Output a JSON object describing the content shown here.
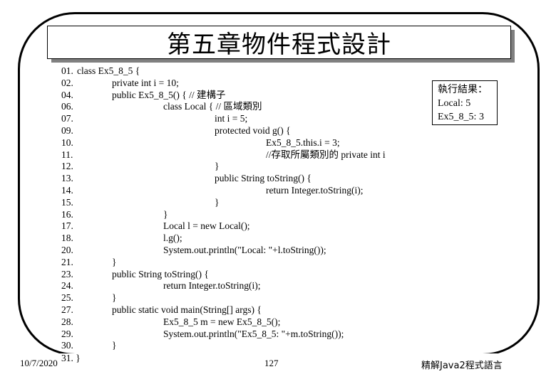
{
  "slide": {
    "title": "第五章物件程式設計",
    "footer": {
      "date": "10/7/2020",
      "page_number": "127",
      "book_title": "精解Java2程式語言"
    }
  },
  "code": {
    "lines": [
      {
        "num": "01.",
        "indent": 0,
        "text": "class Ex5_8_5 {"
      },
      {
        "num": "02.",
        "indent": 1,
        "text": "private int i = 10;"
      },
      {
        "num": "04.",
        "indent": 1,
        "text": "public Ex5_8_5() { // 建構子"
      },
      {
        "num": "06.",
        "indent": 2,
        "text": "class Local { // 區域類別"
      },
      {
        "num": "07.",
        "indent": 3,
        "text": "int i = 5;"
      },
      {
        "num": "09.",
        "indent": 3,
        "text": "protected void g() {"
      },
      {
        "num": "10.",
        "indent": 4,
        "text": "Ex5_8_5.this.i = 3;"
      },
      {
        "num": "11.",
        "indent": 4,
        "text": "//存取所屬類別的 private int i"
      },
      {
        "num": "12.",
        "indent": 3,
        "text": "}"
      },
      {
        "num": "13.",
        "indent": 3,
        "text": "public String toString() {"
      },
      {
        "num": "14.",
        "indent": 4,
        "text": "return Integer.toString(i);"
      },
      {
        "num": "15.",
        "indent": 3,
        "text": "}"
      },
      {
        "num": "16.",
        "indent": 2,
        "text": "}"
      },
      {
        "num": "17.",
        "indent": 2,
        "text": "Local l = new Local();"
      },
      {
        "num": "18.",
        "indent": 2,
        "text": "l.g();"
      },
      {
        "num": "20.",
        "indent": 2,
        "text": "System.out.println(\"Local: \"+l.toString());"
      },
      {
        "num": "21.",
        "indent": 1,
        "text": "}"
      },
      {
        "num": "23.",
        "indent": 1,
        "text": "public String toString() {"
      },
      {
        "num": "24.",
        "indent": 2,
        "text": "return Integer.toString(i);"
      },
      {
        "num": "25.",
        "indent": 1,
        "text": "}"
      },
      {
        "num": "27.",
        "indent": 1,
        "text": "public static void main(String[] args) {"
      },
      {
        "num": "28.",
        "indent": 2,
        "text": "Ex5_8_5 m = new Ex5_8_5();"
      },
      {
        "num": "29.",
        "indent": 2,
        "text": "System.out.println(\"Ex5_8_5: \"+m.toString());"
      },
      {
        "num": "30.",
        "indent": 1,
        "text": "}"
      }
    ],
    "last_line": {
      "num": "31.",
      "text": "}"
    }
  },
  "result_box": {
    "heading": "執行結果：",
    "lines": [
      "Local: 5",
      "Ex5_8_5: 3"
    ]
  }
}
